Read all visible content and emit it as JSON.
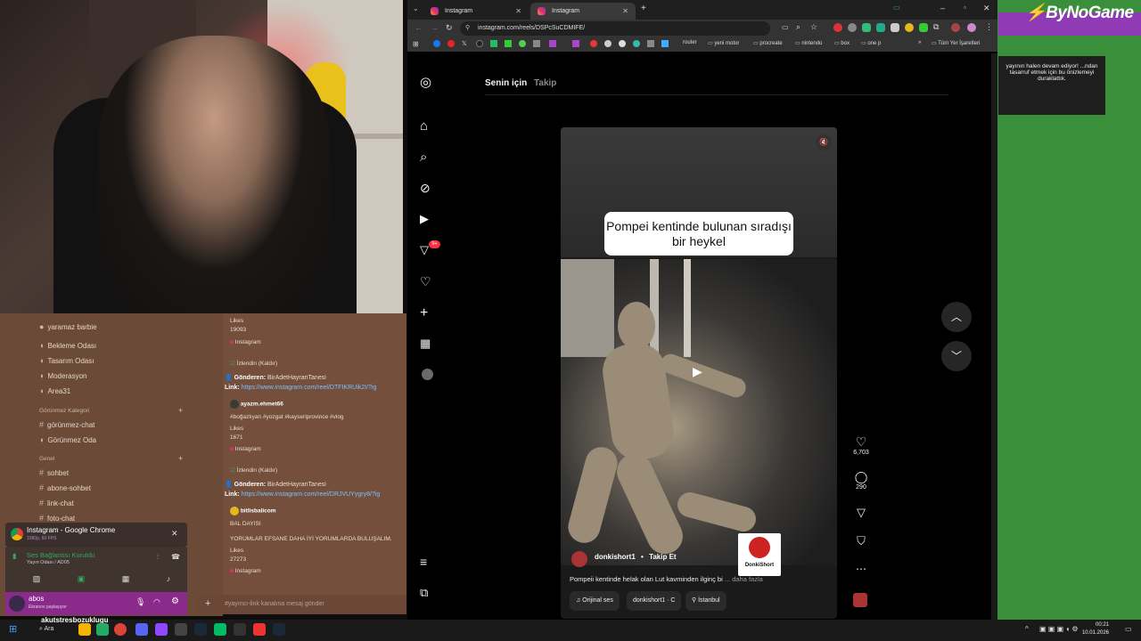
{
  "browser": {
    "tabs": [
      {
        "label": "Instagram",
        "active": false
      },
      {
        "label": "Instagram",
        "active": true
      }
    ],
    "url": "instagram.com/reels/DSPcSuCDMIFE/",
    "bookmarks": [
      "router",
      "yeni motor",
      "procreate",
      "nintendo",
      "box",
      "one p",
      "Tüm Yer İşaretleri"
    ]
  },
  "instagram": {
    "nav_tabs": [
      "Senin için",
      "Takip"
    ],
    "notification_badge": "9+",
    "reel": {
      "overlay_text": "Pompei kentinde bulunan sıradışı bir heykel",
      "username": "donkishort1",
      "follow_label": "Takip Et",
      "caption": "Pompeii kentinde helak olan Lut kavminden ilginç bi",
      "more_label": "... daha fazla",
      "audio": "Orijinal ses",
      "audio_author": "donkishort1 · C",
      "location": "İstanbul",
      "badge_label": "DonkiShort"
    },
    "likes": "6,703",
    "comments": "290"
  },
  "discord": {
    "channels_top": [
      {
        "label": "yaramaz barbie",
        "type": "user"
      },
      {
        "label": "Bekleme Odası",
        "type": "voice"
      },
      {
        "label": "Tasarım Odası",
        "type": "voice"
      },
      {
        "label": "Moderasyon",
        "type": "voice"
      },
      {
        "label": "Area31",
        "type": "voice"
      }
    ],
    "category_hidden": "Görünmez Kategori",
    "hidden_channels": [
      "görünmez-chat",
      "Görünmez Oda"
    ],
    "category_general": "Genel",
    "general_channels": [
      "sohbet",
      "abone-sohbet",
      "link-chat",
      "foto-chat"
    ],
    "stream_title": "Instagram - Google Chrome",
    "stream_quality": "1080p, 60 FPS",
    "voice_status": "Ses Bağlantısı Kuruldu",
    "voice_channel": "Yayın Odası / AD05",
    "username": "abos",
    "user_status": "Ekranını paylaşıyor",
    "chat_placeholder": "#yayıncı-link kanalına mesaj gönder",
    "chat": [
      {
        "kind": "likes_label",
        "text": "Likes"
      },
      {
        "kind": "likes_value",
        "text": "19093"
      },
      {
        "kind": "source",
        "text": "Instagram"
      },
      {
        "kind": "watched",
        "text": "İzlendin (Kaldır)"
      },
      {
        "kind": "sender",
        "label": "Gönderen:",
        "text": "BirAdetHayranTanesi"
      },
      {
        "kind": "link",
        "label": "Link:",
        "text": "https://www.instagram.com/reel/DTFIKRUik2I/?ig"
      },
      {
        "kind": "author",
        "text": "ayazm.ehmet66"
      },
      {
        "kind": "tags",
        "text": "#boğazlıyan #yozgat #kayseriprovince #vlog"
      },
      {
        "kind": "likes_label",
        "text": "Likes"
      },
      {
        "kind": "likes_value",
        "text": "1671"
      },
      {
        "kind": "source",
        "text": "Instagram"
      },
      {
        "kind": "watched",
        "text": "İzlendin (Kaldır)"
      },
      {
        "kind": "sender",
        "label": "Gönderen:",
        "text": "BirAdetHayranTanesi"
      },
      {
        "kind": "link",
        "label": "Link:",
        "text": "https://www.instagram.com/reel/DRJVUYygry8/?ig"
      },
      {
        "kind": "author",
        "text": "bitlisbalicom"
      },
      {
        "kind": "plain",
        "text": "BAL DAYISI"
      },
      {
        "kind": "plain",
        "text": "YORUMLAR EFSANE DAHA İYİ YORUMLARDA BULUŞALIM."
      },
      {
        "kind": "likes_label",
        "text": "Likes"
      },
      {
        "kind": "likes_value",
        "text": "27273"
      },
      {
        "kind": "source",
        "text": "Instagram"
      }
    ]
  },
  "overlay": {
    "logo": "ByNoGame",
    "notice": "yayının halen devam ediyor! ...ndan tasarruf etmek için bu önizlemeyi duraklattık."
  },
  "taskbar": {
    "search_label": "Ara",
    "ticker": "akutstresbozuklugu",
    "time": "00:21",
    "date": "10.01.2026"
  },
  "colors": {
    "discord_sidebar": "#6b4a38",
    "instagram_bg": "#000000",
    "accent_green": "#3a8f3a",
    "link_blue": "#7cc0ff"
  }
}
